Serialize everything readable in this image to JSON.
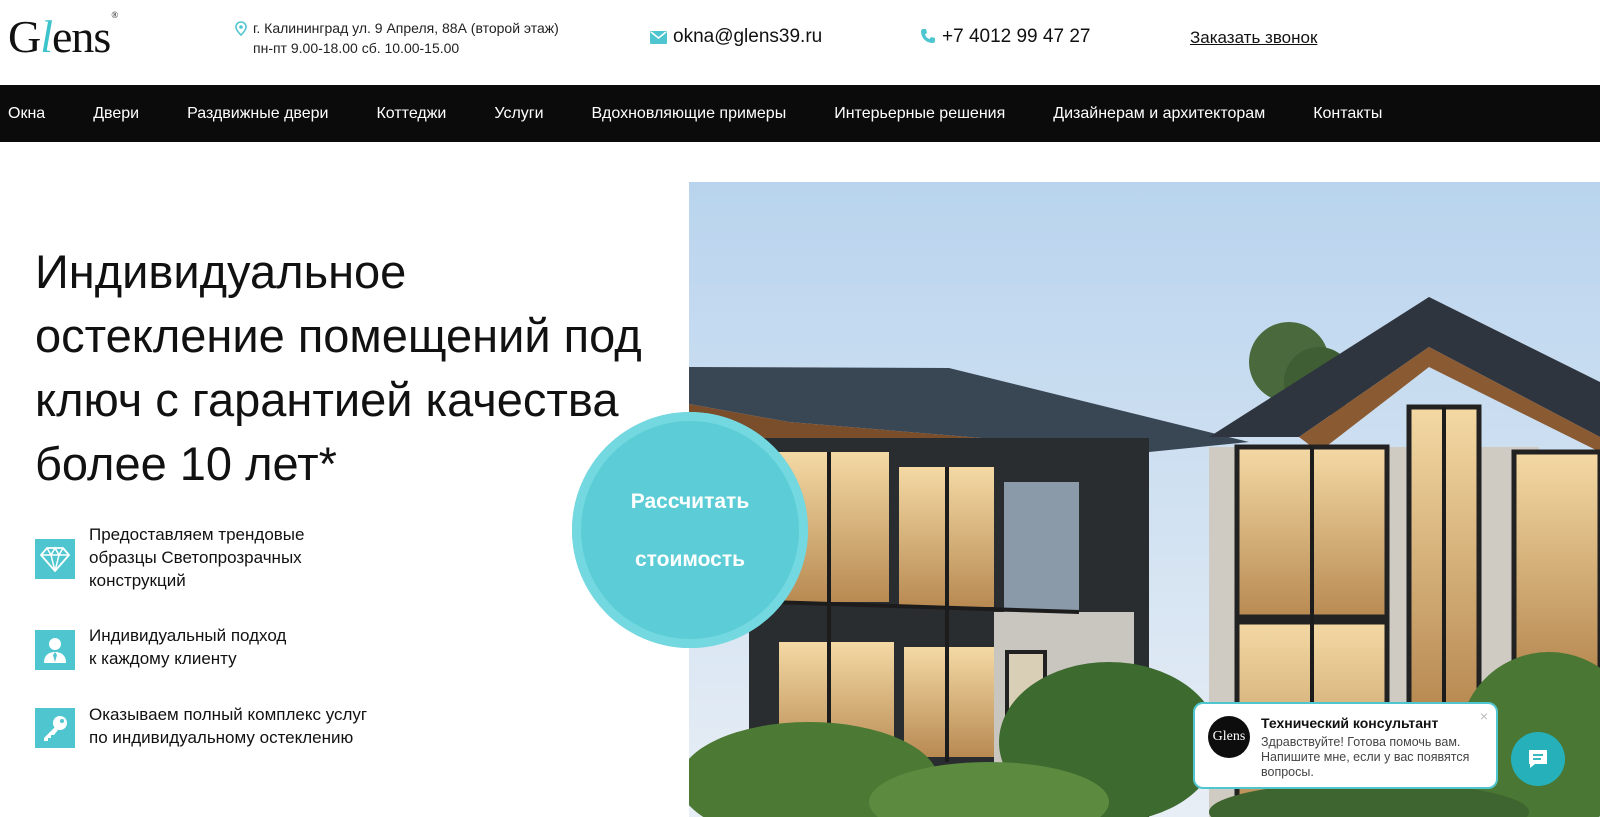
{
  "header": {
    "logo": {
      "part1": "G",
      "slash": "l",
      "part2": "ens",
      "reg": "®"
    },
    "address_line1": "г. Калининград ул. 9 Апреля, 88А (второй этаж)",
    "address_line2": "пн-пт 9.00-18.00 сб. 10.00-15.00",
    "email": "okna@glens39.ru",
    "phone": "+7 4012 99 47 27",
    "callback": "Заказать звонок"
  },
  "nav": {
    "items": [
      {
        "label": "Окна"
      },
      {
        "label": "Двери"
      },
      {
        "label": "Раздвижные двери"
      },
      {
        "label": "Коттеджи"
      },
      {
        "label": "Услуги"
      },
      {
        "label": "Вдохновляющие примеры"
      },
      {
        "label": "Интерьерные решения"
      },
      {
        "label": "Дизайнерам и архитекторам"
      },
      {
        "label": "Контакты"
      }
    ]
  },
  "hero": {
    "title_lines": [
      "Индивидуальное",
      "остекление помещений под",
      "ключ с гарантией качества",
      "более 10 лет*"
    ],
    "cta_line1": "Рассчитать",
    "cta_line2": "стоимость",
    "features": [
      {
        "icon": "diamond-icon",
        "line1": "Предоставляем трендовые",
        "line2": "образцы Светопрозрачных",
        "line3": "конструкций"
      },
      {
        "icon": "person-icon",
        "line1": "Индивидуальный подход",
        "line2": "к каждому клиенту"
      },
      {
        "icon": "key-icon",
        "line1": "Оказываем полный комплекс услуг",
        "line2": "по индивидуальному остеклению"
      }
    ]
  },
  "chat": {
    "avatar_text": "Glens",
    "title": "Технический консультант",
    "message": "Здравствуйте! Готова помочь вам. Напишите мне, если у вас появятся вопросы.",
    "close": "×"
  },
  "colors": {
    "accent": "#4fc6cf",
    "nav_bg": "#0b0b0b",
    "cta": "#5ccdd6"
  }
}
